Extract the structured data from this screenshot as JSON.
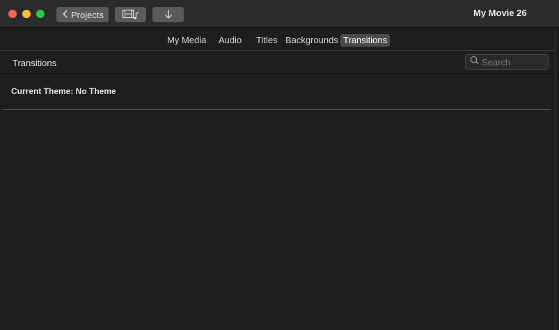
{
  "titlebar": {
    "title": "My Movie 26",
    "projects_label": "Projects",
    "media_icon": "film-music-icon",
    "import_icon": "arrow-down-icon"
  },
  "tabs": [
    {
      "label": "My Media"
    },
    {
      "label": "Audio"
    },
    {
      "label": "Titles"
    },
    {
      "label": "Backgrounds"
    },
    {
      "label": "Transitions",
      "active": true
    }
  ],
  "browser": {
    "title": "Transitions",
    "search_placeholder": "Search",
    "current_theme": "Current Theme: No Theme"
  },
  "colors": {
    "close": "#ff5f57",
    "minimize": "#febc2e",
    "maximize": "#28c840"
  }
}
